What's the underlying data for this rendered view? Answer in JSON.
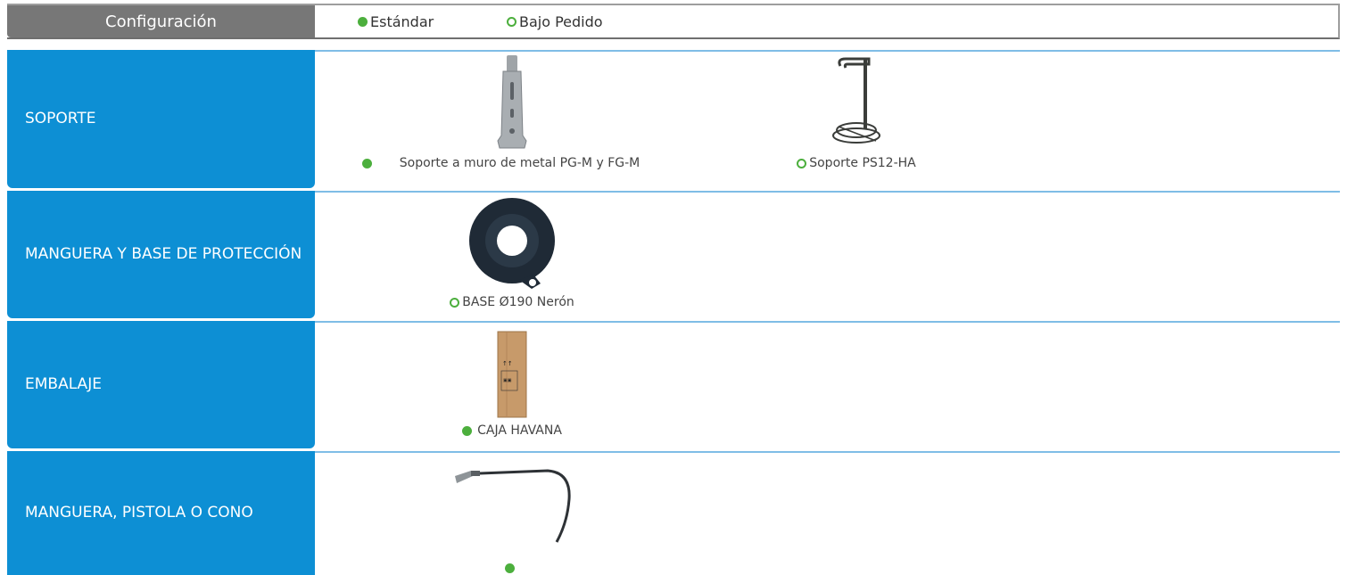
{
  "header": {
    "title": "Configuración",
    "legend_standard": "Estándar",
    "legend_order": "Bajo Pedido"
  },
  "colors": {
    "category_bg": "#0d8fd4",
    "header_bg": "#777777",
    "indicator_green": "#4caf3d",
    "divider": "#7fbde6"
  },
  "rows": [
    {
      "label": "SOPORTE",
      "items": [
        {
          "caption": "Soporte a muro de metal PG-M y FG-M",
          "availability": "standard"
        },
        {
          "caption": "Soporte PS12-HA",
          "availability": "order"
        }
      ]
    },
    {
      "label": "MANGUERA Y BASE DE PROTECCIÓN",
      "items": [
        {
          "caption": "BASE Ø190 Nerón",
          "availability": "order"
        }
      ]
    },
    {
      "label": "EMBALAJE",
      "items": [
        {
          "caption": "CAJA HAVANA",
          "availability": "standard"
        }
      ]
    },
    {
      "label": "MANGUERA, PISTOLA O CONO",
      "items": [
        {
          "caption": "",
          "availability": "standard"
        }
      ]
    }
  ]
}
